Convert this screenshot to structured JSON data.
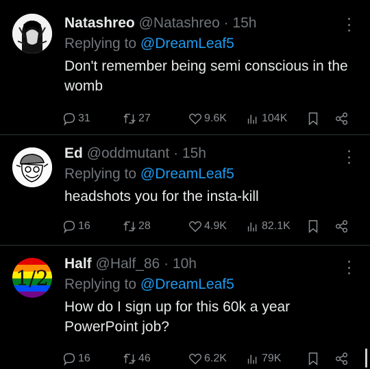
{
  "tweets": [
    {
      "name": "Natashreo",
      "handle": "@Natashreo",
      "time": "· 15h",
      "replying_prefix": "Replying to",
      "replying_to": "@DreamLeaf5",
      "text": "Don't remember being semi conscious in the womb",
      "replies": "31",
      "retweets": "27",
      "likes": "9.6K",
      "views": "104K"
    },
    {
      "name": "Ed",
      "handle": "@oddmutant",
      "time": "· 15h",
      "replying_prefix": "Replying to",
      "replying_to": "@DreamLeaf5",
      "text": "headshots you for the insta-kill",
      "replies": "16",
      "retweets": "28",
      "likes": "4.9K",
      "views": "82.1K"
    },
    {
      "name": "Half",
      "handle": "@Half_86",
      "time": "· 10h",
      "replying_prefix": "Replying to",
      "replying_to": "@DreamLeaf5",
      "text": "How do I sign up for this 60k a year PowerPoint job?",
      "replies": "16",
      "retweets": "46",
      "likes": "6.2K",
      "views": "79K",
      "avatar_text": "1/2"
    }
  ],
  "colors": {
    "background": "#000000",
    "text": "#e7e9ea",
    "muted": "#71767b",
    "mention": "#1d9bf0",
    "divider": "#2f3336"
  },
  "icons": [
    "reply-icon",
    "retweet-icon",
    "like-icon",
    "views-icon",
    "bookmark-icon",
    "share-icon",
    "more-icon"
  ]
}
